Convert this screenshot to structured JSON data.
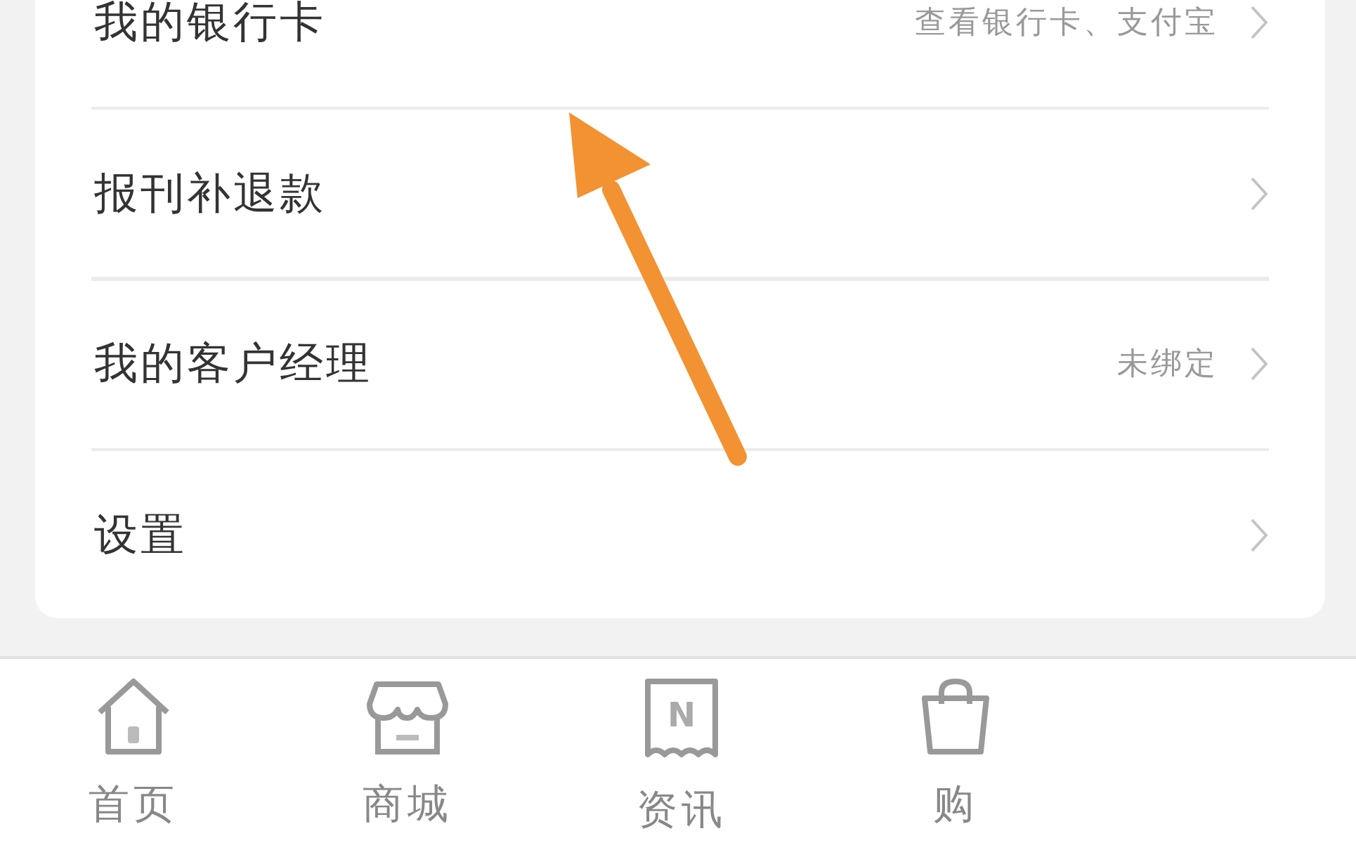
{
  "menu_items": [
    {
      "label": "我的银行卡",
      "detail": "查看银行卡、支付宝"
    },
    {
      "label": "报刊补退款"
    },
    {
      "label": "我的客户经理",
      "detail": "未绑定"
    },
    {
      "label": "设置"
    }
  ],
  "tab_bar": [
    {
      "kind": "home",
      "label": "首页"
    },
    {
      "kind": "store",
      "label": "商城"
    },
    {
      "kind": "news",
      "label": "资讯",
      "icon_letter": "N"
    },
    {
      "kind": "cart",
      "label": "购"
    }
  ]
}
